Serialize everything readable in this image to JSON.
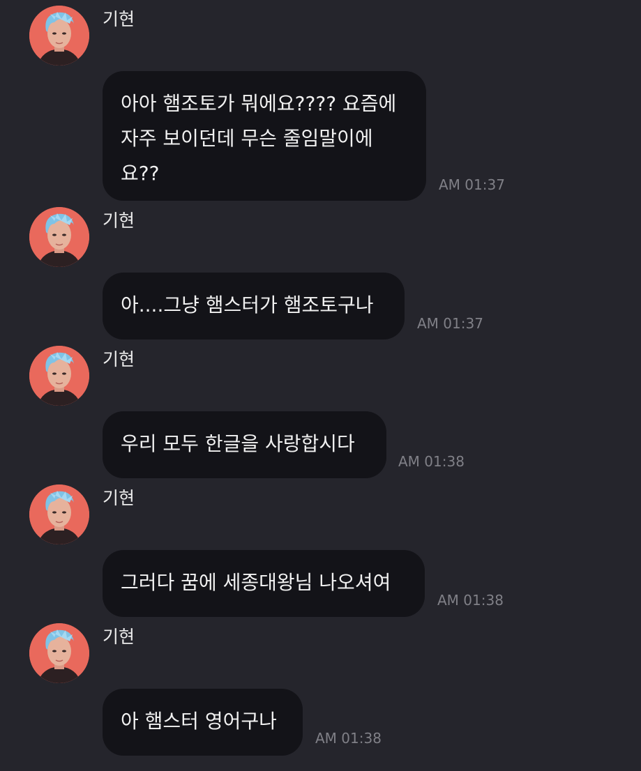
{
  "messages": [
    {
      "sender": "기현",
      "avatar_icon": "profile-photo",
      "text": "아아 햄조토가 뭐에요???? 요즘에\n 자주 보이던데 무슨 줄임말이에\n요??",
      "time": "AM 01:37"
    },
    {
      "sender": "기현",
      "avatar_icon": "profile-photo",
      "text": "아....그냥 햄스터가 햄조토구나",
      "time": "AM 01:37"
    },
    {
      "sender": "기현",
      "avatar_icon": "profile-photo",
      "text": "우리 모두 한글을 사랑합시다",
      "time": "AM 01:38"
    },
    {
      "sender": "기현",
      "avatar_icon": "profile-photo",
      "text": "그러다 꿈에 세종대왕님 나오셔여",
      "time": "AM 01:38"
    },
    {
      "sender": "기현",
      "avatar_icon": "profile-photo",
      "text": "아 햄스터 영어구나",
      "time": "AM 01:38"
    }
  ],
  "colors": {
    "background": "#25252c",
    "bubble": "#131318",
    "avatar_bg": "#e9695c",
    "hair": "#7fc3e6",
    "time_text": "#808087"
  }
}
